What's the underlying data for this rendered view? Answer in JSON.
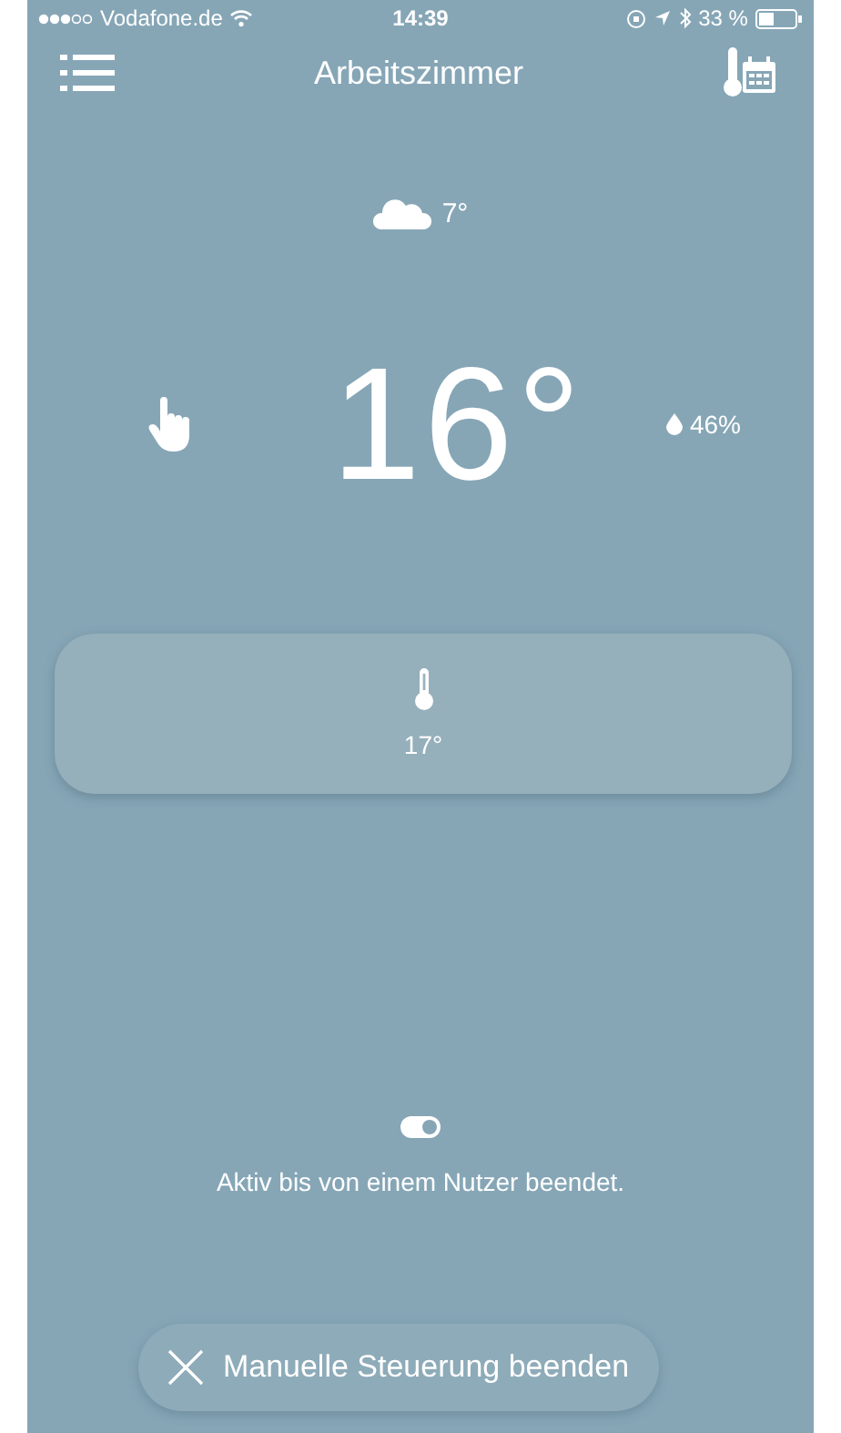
{
  "status_bar": {
    "carrier": "Vodafone.de",
    "time": "14:39",
    "battery": "33 %"
  },
  "nav": {
    "title": "Arbeitszimmer"
  },
  "outdoor": {
    "temperature": "7°"
  },
  "room": {
    "temperature": "16°",
    "humidity": "46%"
  },
  "setpoint": {
    "temperature": "17°"
  },
  "mode": {
    "on": true,
    "description": "Aktiv bis von einem Nutzer beendet."
  },
  "end_button": {
    "label": "Manuelle Steuerung beenden"
  }
}
